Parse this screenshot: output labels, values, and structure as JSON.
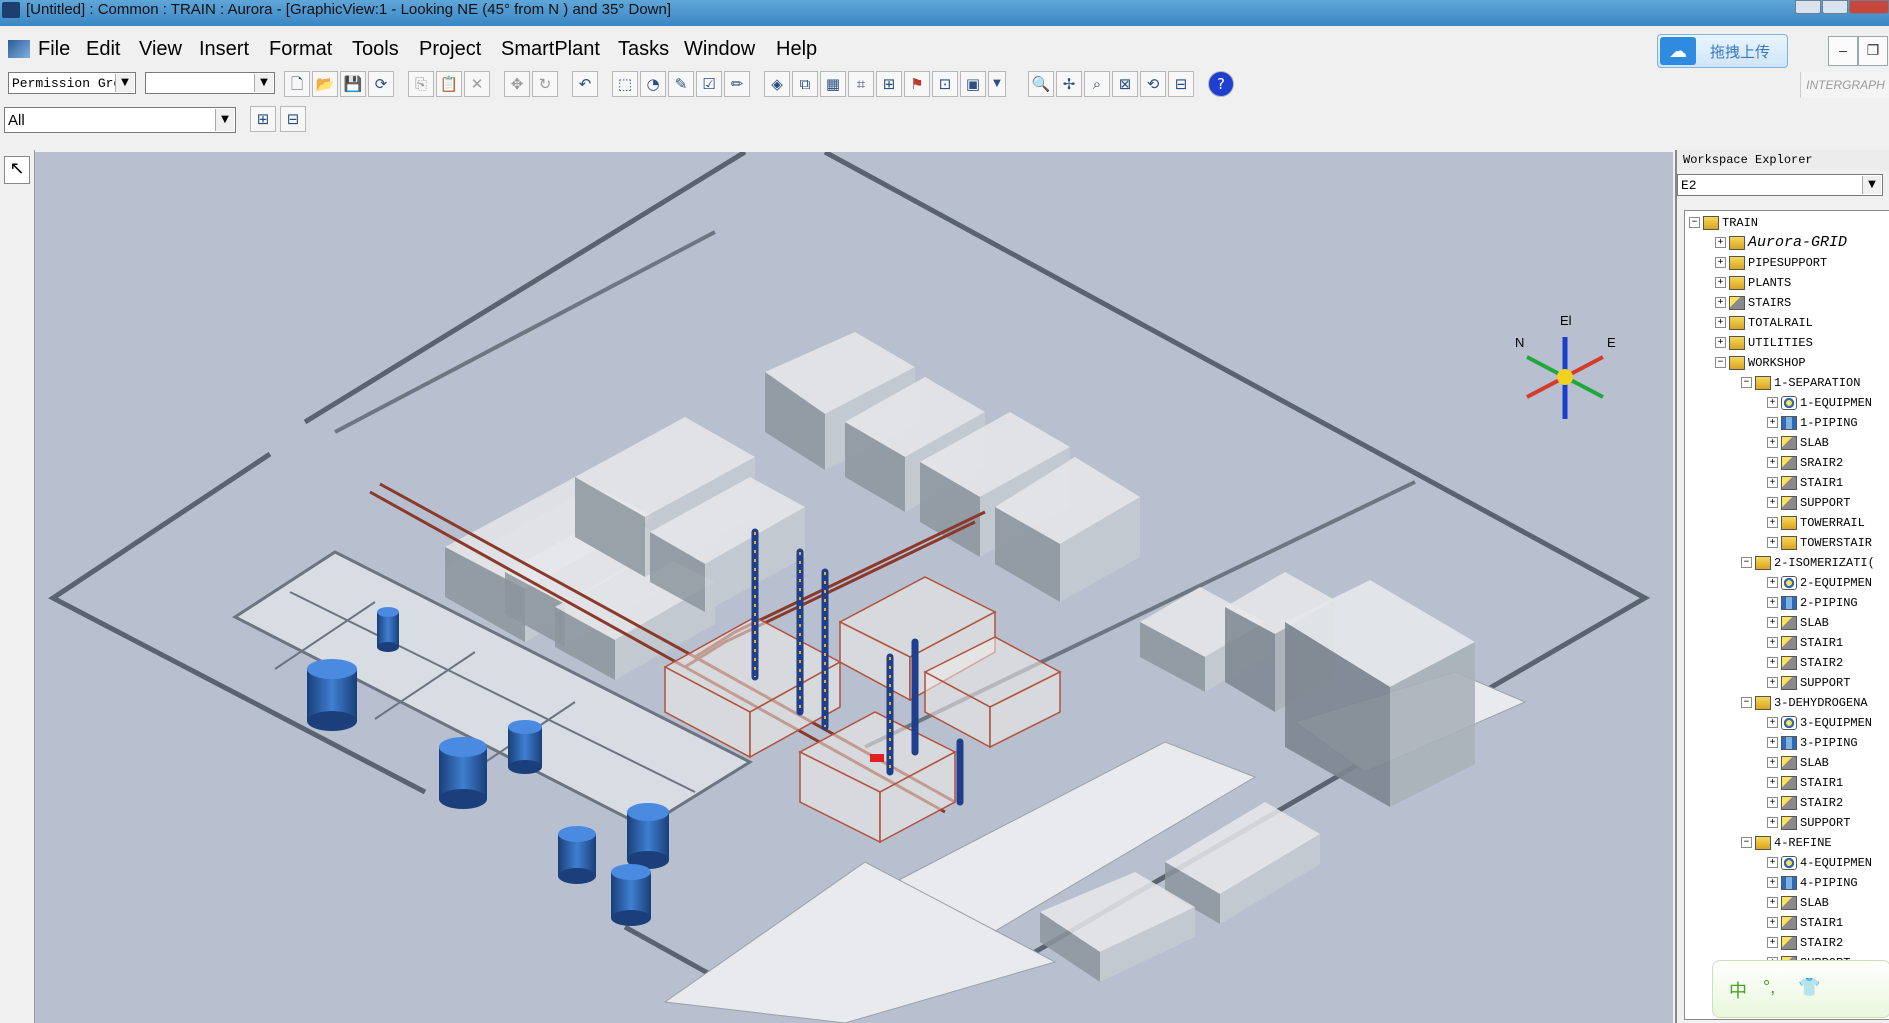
{
  "window": {
    "title": "[Untitled] : Common : TRAIN : Aurora - [GraphicView:1 - Looking NE (45° from N ) and 35° Down]"
  },
  "menu": {
    "items": [
      "File",
      "Edit",
      "View",
      "Insert",
      "Format",
      "Tools",
      "Project",
      "SmartPlant",
      "Tasks",
      "Window",
      "Help"
    ]
  },
  "cloud_upload": {
    "label": "拖拽上传"
  },
  "toolbar": {
    "permission_group": "Permission Gro",
    "filter_value": "All",
    "brand": "INTERGRAPH"
  },
  "compass": {
    "el": "El",
    "n": "N",
    "e": "E"
  },
  "explorer": {
    "title": "Workspace Explorer",
    "filter_value": "E2",
    "tree": [
      {
        "label": "TRAIN",
        "level": 0,
        "expanded": true,
        "icon": "root-icon"
      },
      {
        "label": "Aurora-GRID",
        "level": 1,
        "expanded": false,
        "icon": "folder-icon",
        "italic": true
      },
      {
        "label": "PIPESUPPORT",
        "level": 1,
        "expanded": false,
        "icon": "folder-icon"
      },
      {
        "label": "PLANTS",
        "level": 1,
        "expanded": false,
        "icon": "folder-icon"
      },
      {
        "label": "STAIRS",
        "level": 1,
        "expanded": false,
        "icon": "structure-icon"
      },
      {
        "label": "TOTALRAIL",
        "level": 1,
        "expanded": false,
        "icon": "folder-icon"
      },
      {
        "label": "UTILITIES",
        "level": 1,
        "expanded": false,
        "icon": "folder-icon"
      },
      {
        "label": "WORKSHOP",
        "level": 1,
        "expanded": true,
        "icon": "folder-icon"
      },
      {
        "label": "1-SEPARATION",
        "level": 2,
        "expanded": true,
        "icon": "folder-icon"
      },
      {
        "label": "1-EQUIPMEN",
        "level": 3,
        "expanded": false,
        "icon": "equipment-icon"
      },
      {
        "label": "1-PIPING",
        "level": 3,
        "expanded": false,
        "icon": "piping-icon"
      },
      {
        "label": "SLAB",
        "level": 3,
        "expanded": false,
        "icon": "structure-icon"
      },
      {
        "label": "SRAIR2",
        "level": 3,
        "expanded": false,
        "icon": "structure-icon"
      },
      {
        "label": "STAIR1",
        "level": 3,
        "expanded": false,
        "icon": "structure-icon"
      },
      {
        "label": "SUPPORT",
        "level": 3,
        "expanded": false,
        "icon": "structure-icon"
      },
      {
        "label": "TOWERRAIL",
        "level": 3,
        "expanded": false,
        "icon": "folder-icon"
      },
      {
        "label": "TOWERSTAIR",
        "level": 3,
        "expanded": false,
        "icon": "folder-icon"
      },
      {
        "label": "2-ISOMERIZATI(",
        "level": 2,
        "expanded": true,
        "icon": "folder-icon"
      },
      {
        "label": "2-EQUIPMEN",
        "level": 3,
        "expanded": false,
        "icon": "equipment-icon"
      },
      {
        "label": "2-PIPING",
        "level": 3,
        "expanded": false,
        "icon": "piping-icon"
      },
      {
        "label": "SLAB",
        "level": 3,
        "expanded": false,
        "icon": "structure-icon"
      },
      {
        "label": "STAIR1",
        "level": 3,
        "expanded": false,
        "icon": "structure-icon"
      },
      {
        "label": "STAIR2",
        "level": 3,
        "expanded": false,
        "icon": "structure-icon"
      },
      {
        "label": "SUPPORT",
        "level": 3,
        "expanded": false,
        "icon": "structure-icon"
      },
      {
        "label": "3-DEHYDROGENA",
        "level": 2,
        "expanded": true,
        "icon": "folder-icon"
      },
      {
        "label": "3-EQUIPMEN",
        "level": 3,
        "expanded": false,
        "icon": "equipment-icon"
      },
      {
        "label": "3-PIPING",
        "level": 3,
        "expanded": false,
        "icon": "piping-icon"
      },
      {
        "label": "SLAB",
        "level": 3,
        "expanded": false,
        "icon": "structure-icon"
      },
      {
        "label": "STAIR1",
        "level": 3,
        "expanded": false,
        "icon": "structure-icon"
      },
      {
        "label": "STAIR2",
        "level": 3,
        "expanded": false,
        "icon": "structure-icon"
      },
      {
        "label": "SUPPORT",
        "level": 3,
        "expanded": false,
        "icon": "structure-icon"
      },
      {
        "label": "4-REFINE",
        "level": 2,
        "expanded": true,
        "icon": "folder-icon"
      },
      {
        "label": "4-EQUIPMEN",
        "level": 3,
        "expanded": false,
        "icon": "equipment-icon"
      },
      {
        "label": "4-PIPING",
        "level": 3,
        "expanded": false,
        "icon": "piping-icon"
      },
      {
        "label": "SLAB",
        "level": 3,
        "expanded": false,
        "icon": "structure-icon"
      },
      {
        "label": "STAIR1",
        "level": 3,
        "expanded": false,
        "icon": "structure-icon"
      },
      {
        "label": "STAIR2",
        "level": 3,
        "expanded": false,
        "icon": "structure-icon"
      },
      {
        "label": "SUPPORT",
        "level": 3,
        "expanded": false,
        "icon": "structure-icon"
      }
    ]
  },
  "ime": {
    "lang": "中",
    "punct": "°,"
  }
}
